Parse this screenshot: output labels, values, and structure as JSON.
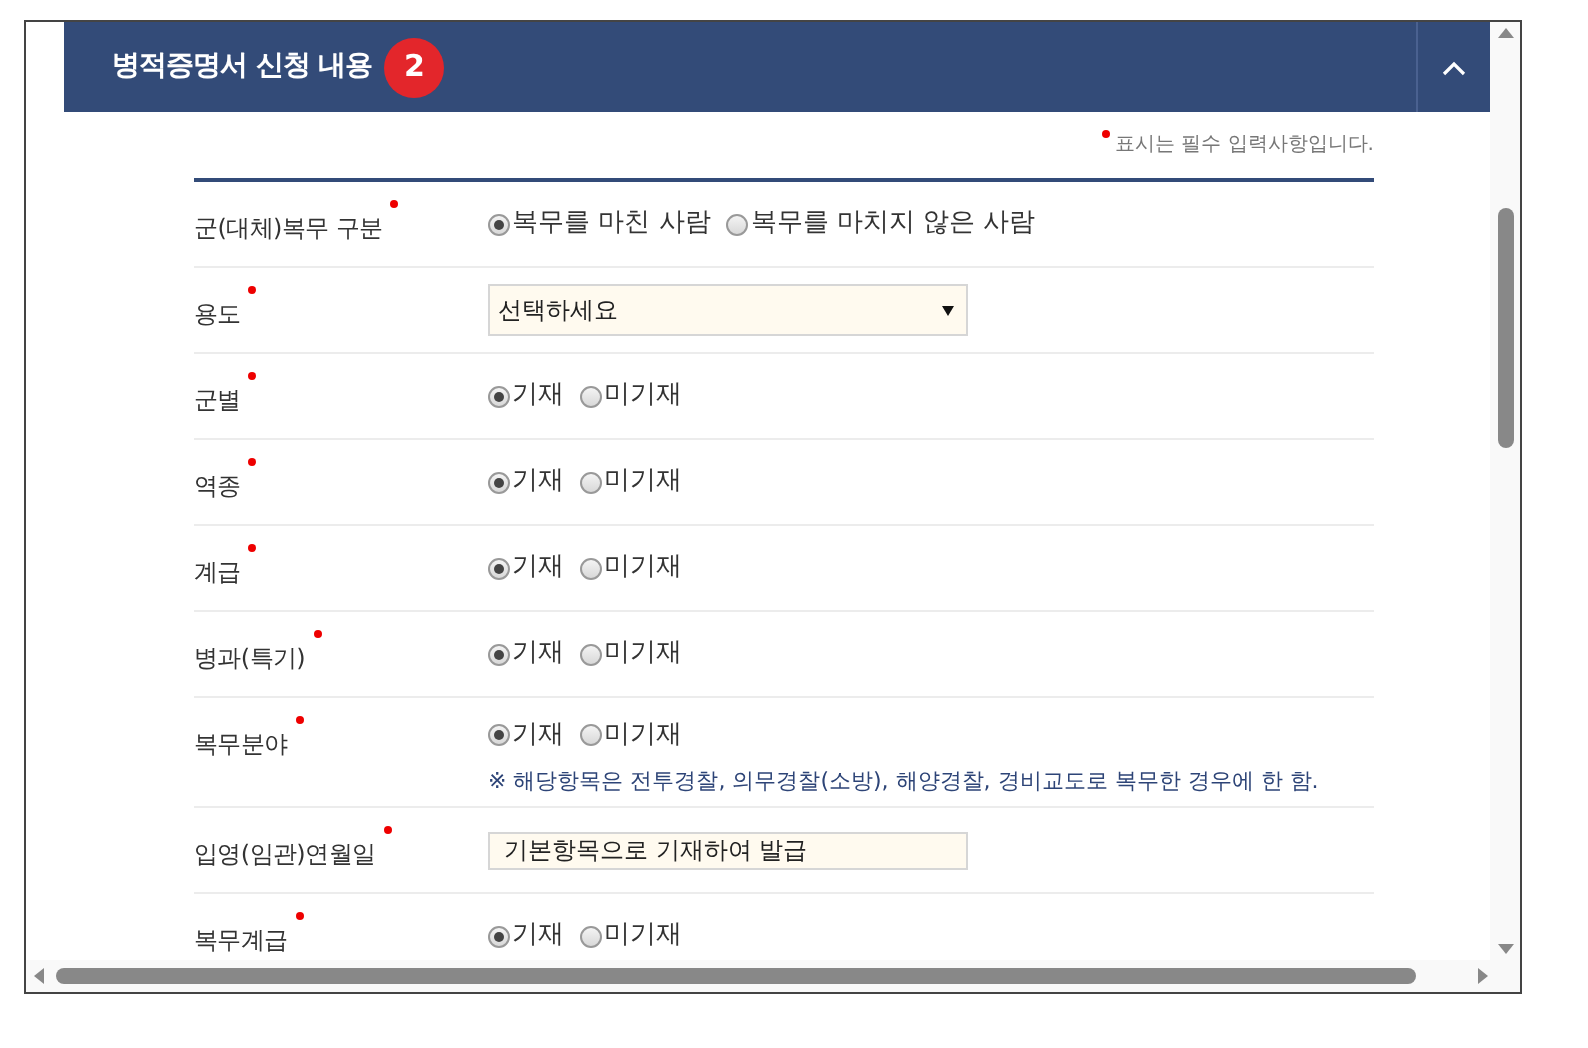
{
  "section": {
    "title": "병적증명서 신청 내용",
    "step": "2",
    "required_note": "표시는 필수 입력사항입니다."
  },
  "rows": [
    {
      "label": "군(대체)복무 구분",
      "kind": "radio",
      "options": [
        {
          "label": "복무를 마친 사람",
          "selected": true
        },
        {
          "label": "복무를 마치지 않은 사람",
          "selected": false
        }
      ]
    },
    {
      "label": "용도",
      "kind": "select",
      "value": "선택하세요"
    },
    {
      "label": "군별",
      "kind": "radio",
      "options": [
        {
          "label": "기재",
          "selected": true
        },
        {
          "label": "미기재",
          "selected": false
        }
      ]
    },
    {
      "label": "역종",
      "kind": "radio",
      "options": [
        {
          "label": "기재",
          "selected": true
        },
        {
          "label": "미기재",
          "selected": false
        }
      ]
    },
    {
      "label": "계급",
      "kind": "radio",
      "options": [
        {
          "label": "기재",
          "selected": true
        },
        {
          "label": "미기재",
          "selected": false
        }
      ]
    },
    {
      "label": "병과(특기)",
      "kind": "radio",
      "options": [
        {
          "label": "기재",
          "selected": true
        },
        {
          "label": "미기재",
          "selected": false
        }
      ]
    },
    {
      "label": "복무분야",
      "kind": "radio",
      "options": [
        {
          "label": "기재",
          "selected": true
        },
        {
          "label": "미기재",
          "selected": false
        }
      ],
      "note": "※ 해당항목은 전투경찰, 의무경찰(소방), 해양경찰, 경비교도로 복무한 경우에 한 함."
    },
    {
      "label": "입영(임관)연월일",
      "kind": "text",
      "value": "기본항목으로 기재하여 발급"
    },
    {
      "label": "복무계급",
      "kind": "radio",
      "options": [
        {
          "label": "기재",
          "selected": true
        },
        {
          "label": "미기재",
          "selected": false
        }
      ]
    }
  ]
}
